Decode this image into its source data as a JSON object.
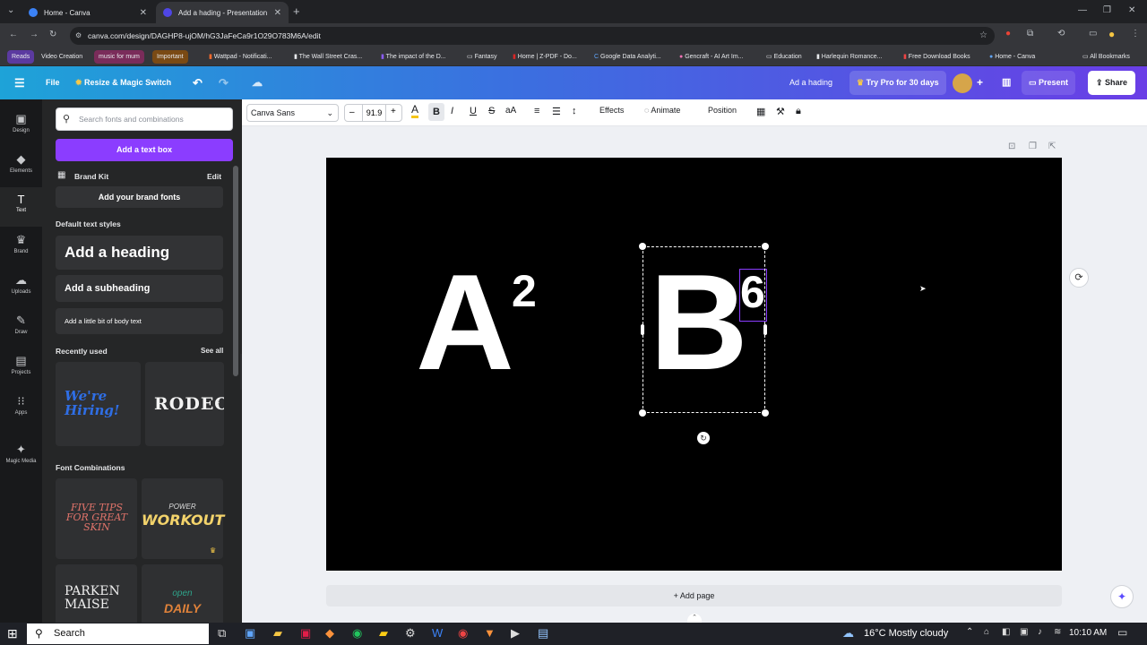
{
  "browser": {
    "tabs": [
      {
        "title": "Home - Canva",
        "favicon_color": "#3b82f6"
      },
      {
        "title": "Add a hading - Presentation",
        "favicon_color": "#4f46e5"
      }
    ],
    "url": "canva.com/design/DAGHP8-ujOM/hG3JaFeCa9r1O29O783M6A/edit",
    "bookmarks": [
      {
        "label": "Reads",
        "kind": "chip",
        "color": "#5b3aa0"
      },
      {
        "label": "Video Creation",
        "kind": "text"
      },
      {
        "label": "music for mum",
        "kind": "chip",
        "color": "#7a2c5a"
      },
      {
        "label": "Important",
        "kind": "chip",
        "color": "#7a4a14"
      },
      {
        "label": "Wattpad - Notificati...",
        "kind": "text"
      },
      {
        "label": "The Wall Street Cras...",
        "kind": "text"
      },
      {
        "label": "The impact of the D...",
        "kind": "text"
      },
      {
        "label": "Fantasy",
        "kind": "text"
      },
      {
        "label": "Home | Z-PDF - Do...",
        "kind": "text"
      },
      {
        "label": "Google Data Analyti...",
        "kind": "text"
      },
      {
        "label": "Gencraft - AI Art Im...",
        "kind": "text"
      },
      {
        "label": "Education",
        "kind": "text"
      },
      {
        "label": "Harlequin Romance...",
        "kind": "text"
      },
      {
        "label": "Free Download Books",
        "kind": "text"
      },
      {
        "label": "Home - Canva",
        "kind": "text"
      }
    ],
    "all_bookmarks": "All Bookmarks"
  },
  "canva_header": {
    "file": "File",
    "resize": "Resize & Magic Switch",
    "design_title": "Ad a hading",
    "try_pro": "Try Pro for 30 days",
    "present": "Present",
    "share": "Share"
  },
  "rail": [
    {
      "label": "Design",
      "glyph": "▣"
    },
    {
      "label": "Elements",
      "glyph": "◆"
    },
    {
      "label": "Text",
      "glyph": "T"
    },
    {
      "label": "Brand",
      "glyph": "♛"
    },
    {
      "label": "Uploads",
      "glyph": "☁"
    },
    {
      "label": "Draw",
      "glyph": "✎"
    },
    {
      "label": "Projects",
      "glyph": "▤"
    },
    {
      "label": "Apps",
      "glyph": "⁝⁝"
    },
    {
      "label": "Magic Media",
      "glyph": "✦"
    }
  ],
  "panel": {
    "search_placeholder": "Search fonts and combinations",
    "add_text_box": "Add a text box",
    "brand_kit": "Brand Kit",
    "brand_edit": "Edit",
    "add_brand_fonts": "Add your brand fonts",
    "default_styles": "Default text styles",
    "heading": "Add a heading",
    "subheading": "Add a subheading",
    "body": "Add a little bit of body text",
    "recently_used": "Recently used",
    "see_all": "See all",
    "recent_1": "We're Hiring!",
    "recent_2": "RODEO",
    "font_combinations": "Font Combinations",
    "combo_1": "FIVE TIPS FOR GREAT SKIN",
    "combo_2_top": "POWER",
    "combo_2": "WORKOUT",
    "combo_3": "PARKEN MAISE",
    "combo_4_top": "open",
    "combo_4": "DAILY"
  },
  "toolbar": {
    "font": "Canva Sans",
    "size_minus": "–",
    "size": "91.9",
    "size_plus": "+",
    "effects": "Effects",
    "animate": "Animate",
    "position": "Position"
  },
  "canvas": {
    "text_a": "A",
    "sup_a": "2",
    "text_b": "B",
    "sup_b": "6",
    "add_page": "+ Add page"
  },
  "taskbar": {
    "search": "Search",
    "weather": "16°C  Mostly cloudy",
    "time": "10:10 AM"
  }
}
